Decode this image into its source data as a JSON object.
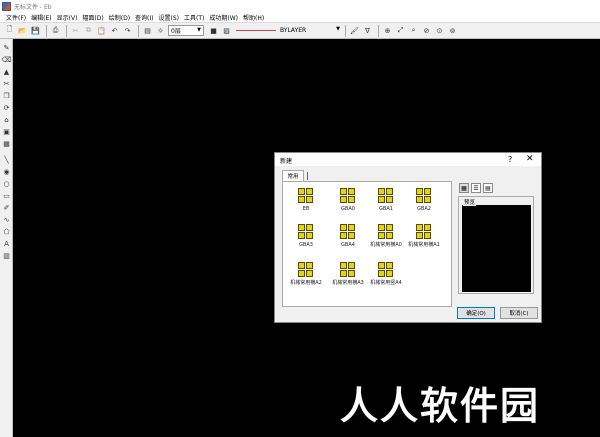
{
  "window": {
    "title": "无标文件 - Eb"
  },
  "menubar": [
    "文件(F)",
    "编辑(E)",
    "显示(V)",
    "辐面(D)",
    "绘制(D)",
    "查询(I)",
    "设置(S)",
    "工具(T)",
    "成功期(W)",
    "帮助(H)"
  ],
  "toolbar": {
    "layer_value": "0层",
    "linetype_value": "BYLAYER"
  },
  "dialog": {
    "title": "新建",
    "help": "?",
    "close": "✕",
    "tab": "常用",
    "templates": [
      "EB",
      "GBA0",
      "GBA1",
      "GBA2",
      "GBA3",
      "GBA4",
      "机械常用横A0",
      "机械常用横A1",
      "机械常用横A2",
      "机械常用横A3",
      "机械常用竖A4"
    ],
    "preview_label": "预览",
    "ok_label": "确定(O)",
    "cancel_label": "取消(C)"
  },
  "watermark": "人人软件园"
}
